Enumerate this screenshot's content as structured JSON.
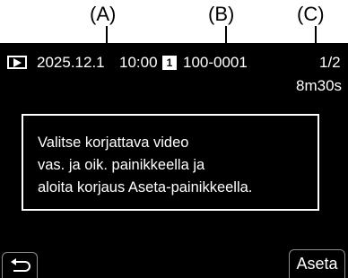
{
  "callouts": {
    "a": "(A)",
    "b": "(B)",
    "c": "(C)"
  },
  "status_bar": {
    "mode_icon": "playback-icon",
    "date": "2025.12.1",
    "time": "10:00",
    "card_slot": "1",
    "file_number": "100-0001",
    "counter": "1/2",
    "duration": "8m30s"
  },
  "message": {
    "line1": "Valitse korjattava video",
    "line2": "vas. ja oik. painikkeella ja",
    "line3": "aloita korjaus Aseta-painikkeella."
  },
  "buttons": {
    "back_icon": "return-arrow-icon",
    "set_label": "Aseta"
  },
  "colors": {
    "screen_background": "#000000",
    "text": "#ffffff",
    "button_border": "#8c8c8c"
  }
}
